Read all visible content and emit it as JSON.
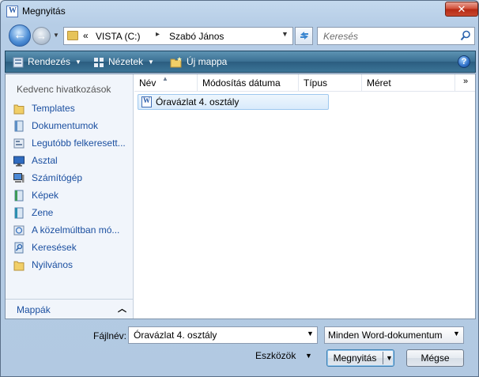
{
  "window": {
    "title": "Megnyitás",
    "close_label": "✕"
  },
  "address_bar": {
    "chevron": "«",
    "segments": [
      "VISTA (C:)",
      "Szabó János"
    ],
    "search_placeholder": "Keresés"
  },
  "toolbar": {
    "organize_label": "Rendezés",
    "views_label": "Nézetek",
    "new_folder_label": "Új mappa",
    "help_label": "?"
  },
  "nav_pane": {
    "favorites_heading": "Kedvenc hivatkozások",
    "items": [
      {
        "label": "Templates",
        "icon": "folder-icon"
      },
      {
        "label": "Dokumentumok",
        "icon": "documents-icon"
      },
      {
        "label": "Legutóbb felkeresett...",
        "icon": "recent-places-icon"
      },
      {
        "label": "Asztal",
        "icon": "desktop-icon"
      },
      {
        "label": "Számítógép",
        "icon": "computer-icon"
      },
      {
        "label": "Képek",
        "icon": "pictures-icon"
      },
      {
        "label": "Zene",
        "icon": "music-icon"
      },
      {
        "label": "A közelmúltban mó...",
        "icon": "recently-changed-icon"
      },
      {
        "label": "Keresések",
        "icon": "searches-icon"
      },
      {
        "label": "Nyilvános",
        "icon": "public-folder-icon"
      }
    ],
    "folders_label": "Mappák"
  },
  "file_list": {
    "columns": [
      "Név",
      "Módosítás dátuma",
      "Típus",
      "Méret"
    ],
    "more_columns": "»",
    "files": [
      {
        "name": "Óravázlat 4. osztály",
        "icon": "word-document-icon"
      }
    ]
  },
  "footer": {
    "filename_label": "Fájlnév:",
    "filename_value": "Óravázlat 4. osztály",
    "filetype_value": "Minden Word-dokumentum",
    "tools_label": "Eszközök",
    "open_label": "Megnyitás",
    "cancel_label": "Mégse"
  },
  "colors": {
    "link_blue": "#1b4fa0",
    "command_bar": "#3a6f92",
    "close_red": "#cf4a33",
    "selection": "#d8eafb"
  }
}
